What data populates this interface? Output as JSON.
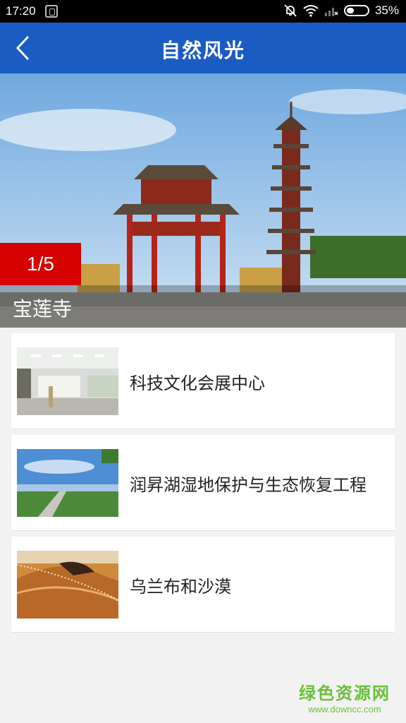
{
  "status_bar": {
    "time": "17:20",
    "battery": "35%"
  },
  "header": {
    "title": "自然风光"
  },
  "banner": {
    "counter": "1/5",
    "caption": "宝莲寺"
  },
  "items": [
    {
      "title": "科技文化会展中心"
    },
    {
      "title": "润昇湖湿地保护与生态恢复工程"
    },
    {
      "title": "乌兰布和沙漠"
    }
  ],
  "watermark": {
    "name": "绿色资源网",
    "url": "www.downcc.com"
  },
  "colors": {
    "app_bar": "#1a5cc2",
    "counter_bg": "#d70000",
    "watermark": "#6bbf3a"
  }
}
